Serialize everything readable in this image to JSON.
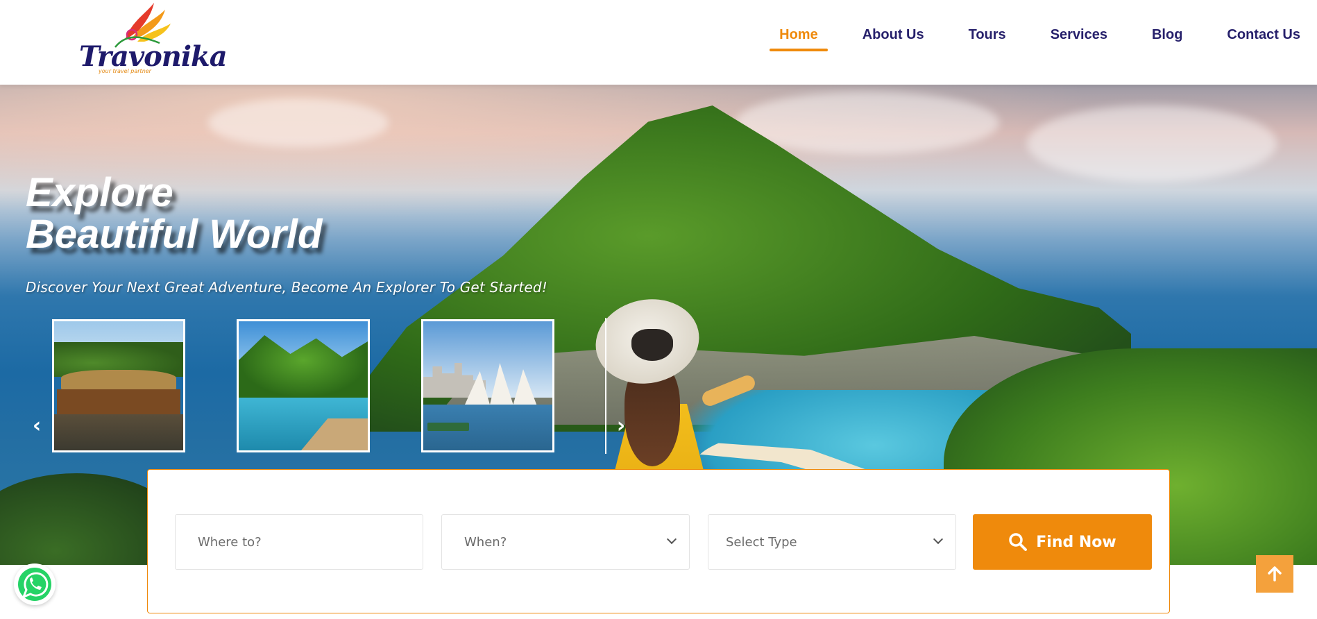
{
  "brand": {
    "name": "Travonika",
    "tagline": "your travel partner",
    "colors": {
      "primary": "#ef8a0c",
      "navy": "#26206b"
    }
  },
  "nav": {
    "items": [
      {
        "label": "Home",
        "active": true
      },
      {
        "label": "About Us",
        "active": false
      },
      {
        "label": "Tours",
        "active": false
      },
      {
        "label": "Services",
        "active": false
      },
      {
        "label": "Blog",
        "active": false
      },
      {
        "label": "Contact Us",
        "active": false
      }
    ]
  },
  "hero": {
    "title_line1": "Explore",
    "title_line2": "Beautiful World",
    "subtitle": "Discover Your Next Great Adventure, Become An Explorer To Get Started!",
    "carousel": {
      "prev_icon": "chevron-left-icon",
      "next_icon": "chevron-right-icon",
      "thumbnails": [
        "houseboat-photo",
        "lagoon-resort-photo",
        "sydney-opera-house-photo"
      ]
    }
  },
  "search": {
    "where_placeholder": "Where to?",
    "when_label": "When?",
    "type_label": "Select Type",
    "button_label": "Find Now",
    "button_icon": "search-icon"
  },
  "widgets": {
    "whatsapp_icon": "whatsapp-icon",
    "scroll_top_icon": "arrow-up-icon"
  }
}
